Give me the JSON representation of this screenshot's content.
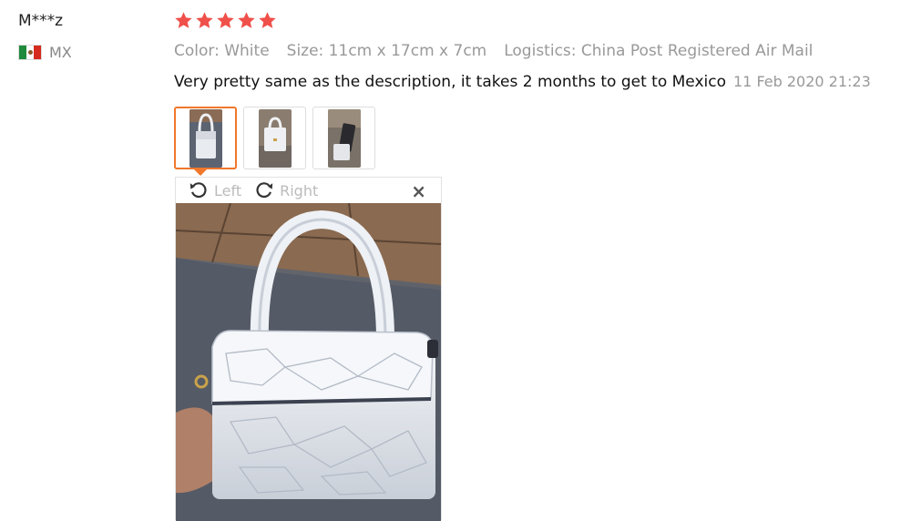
{
  "reviewer": {
    "name": "M***z",
    "country_code": "MX"
  },
  "rating": {
    "stars": 5,
    "max": 5,
    "color": "#f0504a"
  },
  "attributes": {
    "color": "Color: White",
    "size": "Size: 11cm x 17cm x 7cm",
    "logistics": "Logistics: China Post Registered Air Mail"
  },
  "review": {
    "text": "Very pretty same as the description, it takes 2 months to get to Mexico",
    "date": "11 Feb 2020 21:23"
  },
  "thumbnails": {
    "count": 3,
    "selected": 1
  },
  "viewer": {
    "rotate_left": "Left",
    "rotate_right": "Right",
    "close": "×"
  },
  "colors": {
    "accent": "#f0772b",
    "muted": "#999999"
  },
  "icons": [
    "flag-mx-icon",
    "star-icon",
    "rotate-left-icon",
    "rotate-right-icon",
    "close-icon"
  ]
}
